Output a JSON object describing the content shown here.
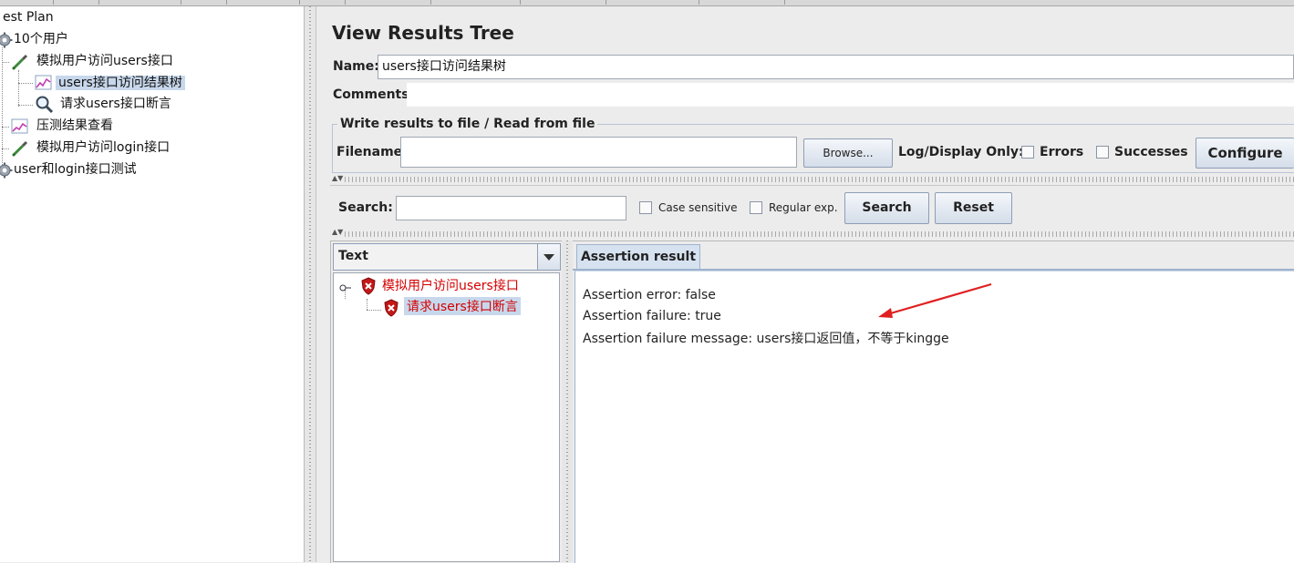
{
  "tree": {
    "items": [
      {
        "label": "est Plan"
      },
      {
        "label": "10个用户"
      },
      {
        "label": "模拟用户访问users接口"
      },
      {
        "label": "users接口访问结果树"
      },
      {
        "label": "请求users接口断言"
      },
      {
        "label": "压测结果查看"
      },
      {
        "label": "模拟用户访问login接口"
      },
      {
        "label": "user和login接口测试"
      }
    ]
  },
  "panel": {
    "title": "View Results Tree",
    "name_label": "Name:",
    "name_value": "users接口访问结果树",
    "comments_label": "Comments:",
    "file_section_title": "Write results to file / Read from file",
    "filename_label": "Filename",
    "filename_value": "",
    "browse_label": "Browse...",
    "log_display_label": "Log/Display Only:",
    "errors_label": "Errors",
    "successes_label": "Successes",
    "configure_label": "Configure"
  },
  "search": {
    "label": "Search:",
    "value": "",
    "case_sensitive_label": "Case sensitive",
    "regular_exp_label": "Regular exp.",
    "search_button": "Search",
    "reset_button": "Reset"
  },
  "results": {
    "renderer_selected": "Text",
    "samples": [
      {
        "label": "模拟用户访问users接口"
      },
      {
        "label": "请求users接口断言"
      }
    ],
    "tab_label": "Assertion result",
    "lines": [
      "Assertion error: false",
      "Assertion failure: true",
      "Assertion failure message: users接口返回值，不等于kingge"
    ]
  },
  "colors": {
    "error_text": "#d40000",
    "selection": "#c8d8ec",
    "arrow": "#e02020"
  }
}
